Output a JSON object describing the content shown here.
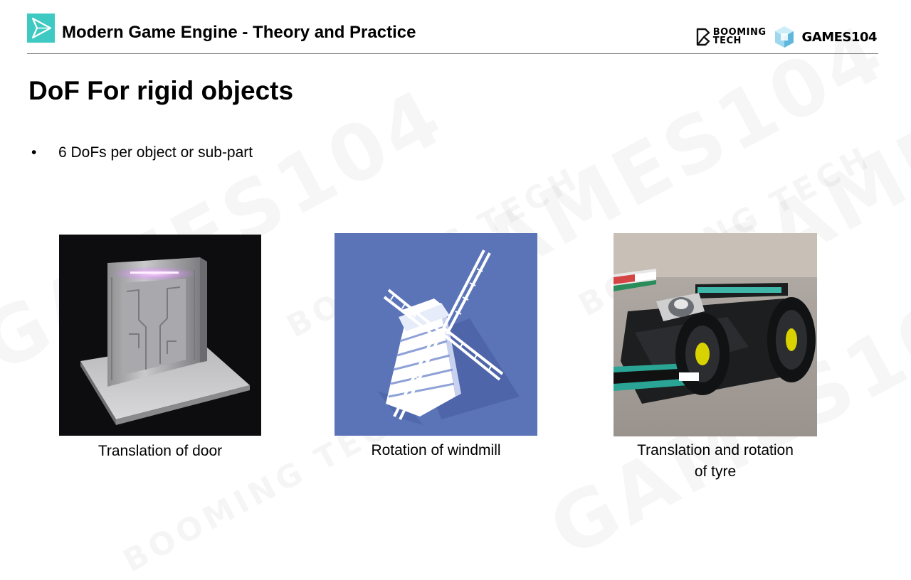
{
  "header": {
    "course_title": "Modern Game Engine - Theory and Practice",
    "logo_icon": "play-triangle-icon",
    "brand_booming": "BOOMING",
    "brand_tech": "TECH",
    "brand_games": "GAMES104"
  },
  "slide": {
    "title": "DoF For rigid objects",
    "bullets": [
      {
        "marker": "•",
        "text": "6 DoFs per object or sub-part"
      }
    ]
  },
  "figures": [
    {
      "image": "sci-fi-door-render",
      "caption": "Translation of door"
    },
    {
      "image": "windmill-render",
      "caption": "Rotation of windmill"
    },
    {
      "image": "f1-car-photo",
      "caption_line1": "Translation and rotation",
      "caption_line2": "of tyre"
    }
  ],
  "watermark_text": "GAMES104",
  "watermark_small": "BOOMING TECH",
  "colors": {
    "accent_teal": "#3ec9c2",
    "windmill_bg": "#5b74b8",
    "door_bg": "#0d0d0f"
  }
}
